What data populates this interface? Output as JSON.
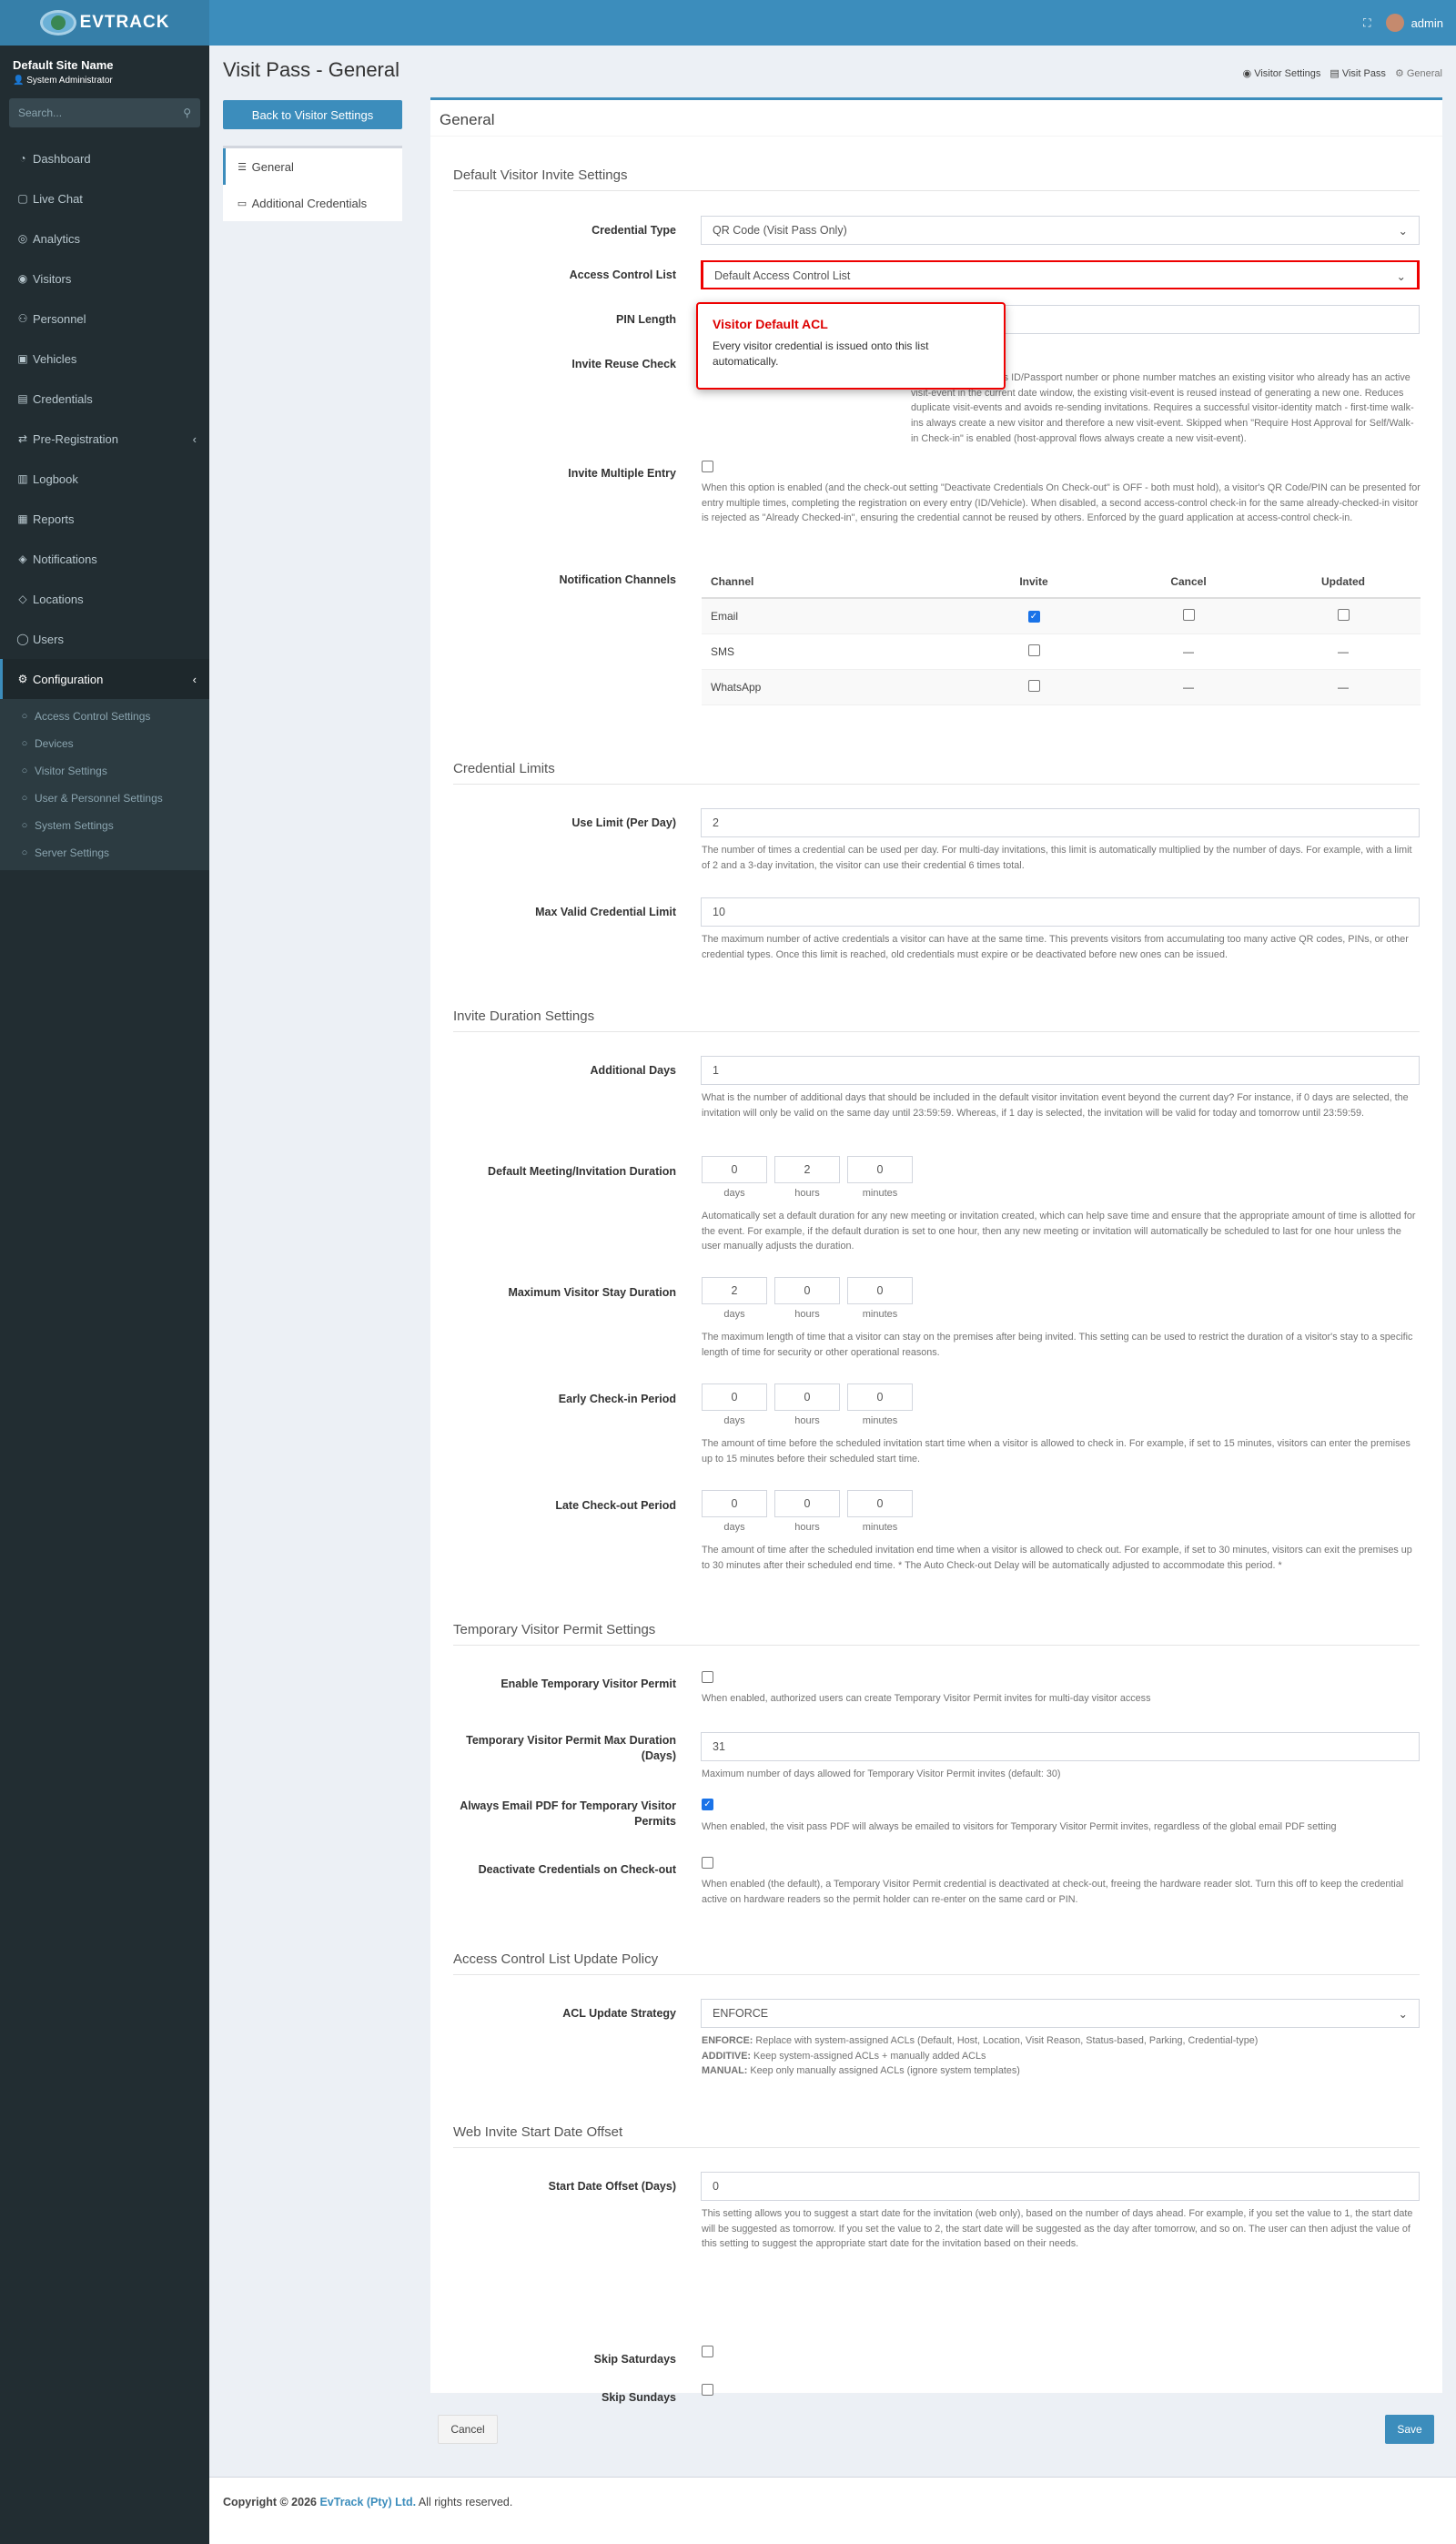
{
  "header": {
    "logo": "EVTRACK",
    "user": "admin"
  },
  "sidebar": {
    "site_name": "Default Site Name",
    "role": "System Administrator",
    "search_placeholder": "Search...",
    "items": [
      {
        "label": "Dashboard",
        "icon": "dashboard-icon"
      },
      {
        "label": "Live Chat",
        "icon": "chat-icon"
      },
      {
        "label": "Analytics",
        "icon": "analytics-icon"
      },
      {
        "label": "Visitors",
        "icon": "eye-icon"
      },
      {
        "label": "Personnel",
        "icon": "users-icon"
      },
      {
        "label": "Vehicles",
        "icon": "car-icon"
      },
      {
        "label": "Credentials",
        "icon": "credentials-icon"
      },
      {
        "label": "Pre-Registration",
        "icon": "share-icon"
      },
      {
        "label": "Logbook",
        "icon": "book-icon"
      },
      {
        "label": "Reports",
        "icon": "reports-icon"
      },
      {
        "label": "Notifications",
        "icon": "bell-icon"
      },
      {
        "label": "Locations",
        "icon": "map-icon"
      },
      {
        "label": "Users",
        "icon": "user-icon"
      },
      {
        "label": "Configuration",
        "icon": "gear-icon"
      }
    ],
    "sub_items": [
      "Access Control Settings",
      "Devices",
      "Visitor Settings",
      "User & Personnel Settings",
      "System Settings",
      "Server Settings"
    ]
  },
  "page": {
    "title": "Visit Pass - General",
    "breadcrumbs": [
      "Visitor Settings",
      "Visit Pass",
      "General"
    ],
    "back_button": "Back to Visitor Settings",
    "side_nav": [
      "General",
      "Additional Credentials"
    ],
    "box_title": "General"
  },
  "sections": {
    "invite": "Default Visitor Invite Settings",
    "limits": "Credential Limits",
    "duration": "Invite Duration Settings",
    "temp": "Temporary Visitor Permit Settings",
    "acl": "Access Control List Update Policy",
    "offset": "Web Invite Start Date Offset"
  },
  "fields": {
    "credential_type": {
      "label": "Credential Type",
      "value": "QR Code (Visit Pass Only)"
    },
    "acl": {
      "label": "Access Control List",
      "value": "Default Access Control List"
    },
    "pin_length": {
      "label": "PIN Length"
    },
    "reuse": {
      "label": "Invite Reuse Check",
      "help": "alk-in) and the visitor's ID/Passport number or phone number matches an existing visitor who already has an active visit-event in the current date window, the existing visit-event is reused instead of generating a new one. Reduces duplicate visit-events and avoids re-sending invitations. Requires a successful visitor-identity match - first-time walk-ins always create a new visitor and therefore a new visit-event. Skipped when \"Require Host Approval for Self/Walk-in Check-in\" is enabled (host-approval flows always create a new visit-event)."
    },
    "multi": {
      "label": "Invite Multiple Entry",
      "help": "When this option is enabled (and the check-out setting \"Deactivate Credentials On Check-out\" is OFF - both must hold), a visitor's QR Code/PIN can be presented for entry multiple times, completing the registration on every entry (ID/Vehicle). When disabled, a second access-control check-in for the same already-checked-in visitor is rejected as \"Already Checked-in\", ensuring the credential cannot be reused by others. Enforced by the guard application at access-control check-in."
    },
    "channels": {
      "label": "Notification Channels",
      "headers": [
        "Channel",
        "Invite",
        "Cancel",
        "Updated"
      ],
      "rows": [
        {
          "name": "Email",
          "invite": true,
          "cancel": false,
          "updated": false
        },
        {
          "name": "SMS",
          "invite": false,
          "cancel": "—",
          "updated": "—"
        },
        {
          "name": "WhatsApp",
          "invite": false,
          "cancel": "—",
          "updated": "—"
        }
      ]
    },
    "use_limit": {
      "label": "Use Limit (Per Day)",
      "value": "2",
      "help": "The number of times a credential can be used per day. For multi-day invitations, this limit is automatically multiplied by the number of days. For example, with a limit of 2 and a 3-day invitation, the visitor can use their credential 6 times total."
    },
    "max_valid": {
      "label": "Max Valid Credential Limit",
      "value": "10",
      "help": "The maximum number of active credentials a visitor can have at the same time. This prevents visitors from accumulating too many active QR codes, PINs, or other credential types. Once this limit is reached, old credentials must expire or be deactivated before new ones can be issued."
    },
    "add_days": {
      "label": "Additional Days",
      "value": "1",
      "help": "What is the number of additional days that should be included in the default visitor invitation event beyond the current day? For instance, if 0 days are selected, the invitation will only be valid on the same day until 23:59:59. Whereas, if 1 day is selected, the invitation will be valid for today and tomorrow until 23:59:59."
    },
    "units": [
      "days",
      "hours",
      "minutes"
    ],
    "meeting": {
      "label": "Default Meeting/Invitation Duration",
      "values": [
        "0",
        "2",
        "0"
      ],
      "help": "Automatically set a default duration for any new meeting or invitation created, which can help save time and ensure that the appropriate amount of time is allotted for the event. For example, if the default duration is set to one hour, then any new meeting or invitation will automatically be scheduled to last for one hour unless the user manually adjusts the duration."
    },
    "max_stay": {
      "label": "Maximum Visitor Stay Duration",
      "values": [
        "2",
        "0",
        "0"
      ],
      "help": "The maximum length of time that a visitor can stay on the premises after being invited. This setting can be used to restrict the duration of a visitor's stay to a specific length of time for security or other operational reasons."
    },
    "early": {
      "label": "Early Check-in Period",
      "values": [
        "0",
        "0",
        "0"
      ],
      "help": "The amount of time before the scheduled invitation start time when a visitor is allowed to check in. For example, if set to 15 minutes, visitors can enter the premises up to 15 minutes before their scheduled start time."
    },
    "late": {
      "label": "Late Check-out Period",
      "values": [
        "0",
        "0",
        "0"
      ],
      "help": "The amount of time after the scheduled invitation end time when a visitor is allowed to check out. For example, if set to 30 minutes, visitors can exit the premises up to 30 minutes after their scheduled end time. * The Auto Check-out Delay will be automatically adjusted to accommodate this period. *"
    },
    "temp_enable": {
      "label": "Enable Temporary Visitor Permit",
      "help": "When enabled, authorized users can create Temporary Visitor Permit invites for multi-day visitor access"
    },
    "temp_max": {
      "label": "Temporary Visitor Permit Max Duration (Days)",
      "value": "31",
      "help": "Maximum number of days allowed for Temporary Visitor Permit invites (default: 30)"
    },
    "temp_pdf": {
      "label": "Always Email PDF for Temporary Visitor Permits",
      "help": "When enabled, the visit pass PDF will always be emailed to visitors for Temporary Visitor Permit invites, regardless of the global email PDF setting"
    },
    "temp_deact": {
      "label": "Deactivate Credentials on Check-out",
      "help": "When enabled (the default), a Temporary Visitor Permit credential is deactivated at check-out, freeing the hardware reader slot. Turn this off to keep the credential active on hardware readers so the permit holder can re-enter on the same card or PIN."
    },
    "acl_strategy": {
      "label": "ACL Update Strategy",
      "value": "ENFORCE",
      "h1k": "ENFORCE:",
      "h1": " Replace with system-assigned ACLs (Default, Host, Location, Visit Reason, Status-based, Parking, Credential-type)",
      "h2k": "ADDITIVE:",
      "h2": " Keep system-assigned ACLs + manually added ACLs",
      "h3k": "MANUAL:",
      "h3": " Keep only manually assigned ACLs (ignore system templates)"
    },
    "offset": {
      "label": "Start Date Offset (Days)",
      "value": "0",
      "help": "This setting allows you to suggest a start date for the invitation (web only), based on the number of days ahead. For example, if you set the value to 1, the start date will be suggested as tomorrow. If you set the value to 2, the start date will be suggested as the day after tomorrow, and so on. The user can then adjust the value of this setting to suggest the appropriate start date for the invitation based on their needs."
    },
    "skip_sat": {
      "label": "Skip Saturdays"
    },
    "skip_sun": {
      "label": "Skip Sundays"
    }
  },
  "tooltip": {
    "title": "Visitor Default ACL",
    "body": "Every visitor credential is issued onto this list automatically."
  },
  "buttons": {
    "cancel": "Cancel",
    "save": "Save"
  },
  "footer": {
    "prefix": "Copyright © 2026 ",
    "company": "EvTrack (Pty) Ltd.",
    "suffix": " All rights reserved."
  }
}
